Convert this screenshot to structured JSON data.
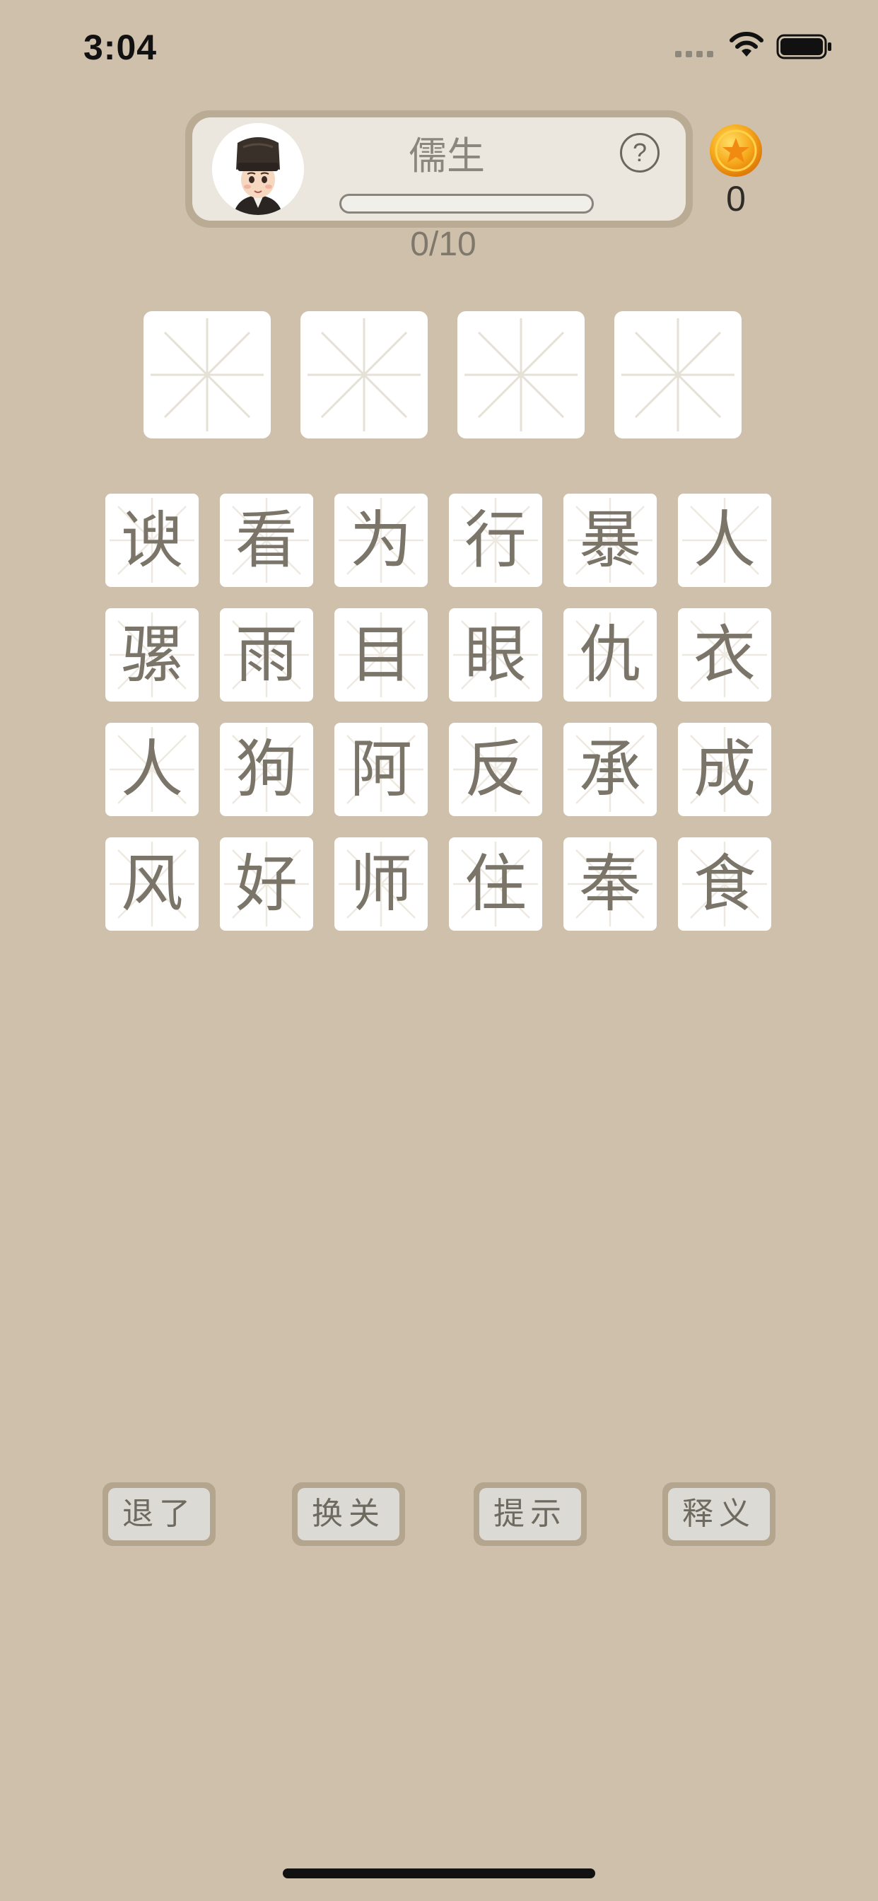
{
  "status_bar": {
    "time": "3:04",
    "wifi_icon": "wifi-icon",
    "battery_icon": "battery-full-icon"
  },
  "header": {
    "avatar_icon": "scholar-avatar-icon",
    "rank_title": "儒生",
    "help_label": "?",
    "progress_fraction": 0.0,
    "progress_text": "0/10",
    "coin_icon": "gold-coin-icon",
    "coins": "0"
  },
  "answer_slots": [
    "",
    "",
    "",
    ""
  ],
  "characters": [
    "谀",
    "看",
    "为",
    "行",
    "暴",
    "人",
    "骡",
    "雨",
    "目",
    "眼",
    "仇",
    "衣",
    "人",
    "狗",
    "阿",
    "反",
    "承",
    "成",
    "风",
    "好",
    "师",
    "住",
    "奉",
    "食"
  ],
  "actions": {
    "quit": "退了",
    "switch_level": "换关",
    "hint": "提示",
    "explain": "释义"
  },
  "colors": {
    "background": "#cfc0ab",
    "tile": "#ffffff",
    "character": "#7a7568",
    "guide_lines": "#e6e1d6"
  }
}
